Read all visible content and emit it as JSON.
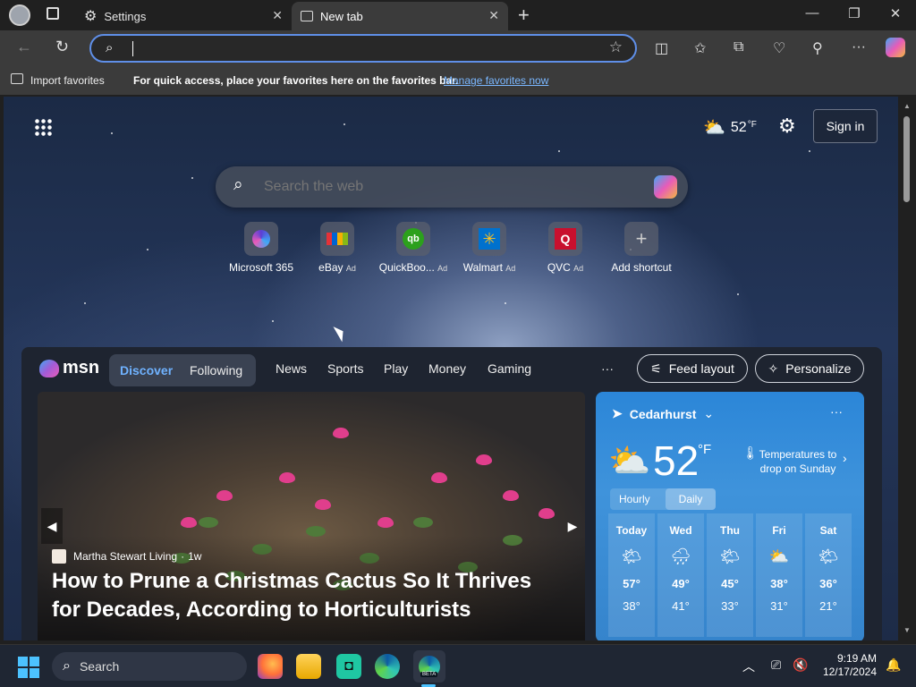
{
  "tabs": [
    {
      "label": "Settings",
      "icon": "gear-icon"
    },
    {
      "label": "New tab",
      "icon": "newtab-icon"
    }
  ],
  "address_bar": {
    "value": "",
    "placeholder": ""
  },
  "favorites_bar": {
    "import_label": "Import favorites",
    "message": "For quick access, place your favorites here on the favorites bar.",
    "manage_link": "Manage favorites now"
  },
  "header": {
    "temperature": "52",
    "unit": "°F",
    "sign_in": "Sign in"
  },
  "search": {
    "placeholder": "Search the web"
  },
  "shortcuts": [
    {
      "label": "Microsoft 365",
      "ad": ""
    },
    {
      "label": "eBay",
      "ad": "Ad"
    },
    {
      "label": "QuickBoo...",
      "ad": "Ad"
    },
    {
      "label": "Walmart",
      "ad": "Ad"
    },
    {
      "label": "QVC",
      "ad": "Ad"
    },
    {
      "label": "Add shortcut",
      "ad": ""
    }
  ],
  "msn": {
    "brand": "msn",
    "toggle": [
      "Discover",
      "Following"
    ],
    "nav": [
      "News",
      "Sports",
      "Play",
      "Money",
      "Gaming"
    ],
    "more": "···",
    "feed_layout": "Feed layout",
    "personalize": "Personalize"
  },
  "article": {
    "source": "Martha Stewart Living",
    "age": "1w",
    "title": "How to Prune a Christmas Cactus So It Thrives for Decades, According to Horticulturists"
  },
  "weather": {
    "location": "Cedarhurst",
    "temperature": "52",
    "unit": "°F",
    "alert": "Temperatures to drop on Sunday",
    "tabs": [
      "Hourly",
      "Daily"
    ],
    "days": [
      {
        "name": "Today",
        "icon": "partly-sunny-icon",
        "hi": "57°",
        "lo": "38°"
      },
      {
        "name": "Wed",
        "icon": "rain-cloud-icon",
        "hi": "49°",
        "lo": "41°"
      },
      {
        "name": "Thu",
        "icon": "partly-sunny-icon",
        "hi": "45°",
        "lo": "33°"
      },
      {
        "name": "Fri",
        "icon": "cloudy-icon",
        "hi": "38°",
        "lo": "31°"
      },
      {
        "name": "Sat",
        "icon": "partly-sunny-icon",
        "hi": "36°",
        "lo": "21°"
      }
    ]
  },
  "taskbar": {
    "search_placeholder": "Search",
    "time": "9:19 AM",
    "date": "12/17/2024",
    "badge": "BETA"
  },
  "colors": {
    "accent": "#5f8fe8",
    "link": "#7ab7ff",
    "weather_blue": "#2b86d8"
  }
}
